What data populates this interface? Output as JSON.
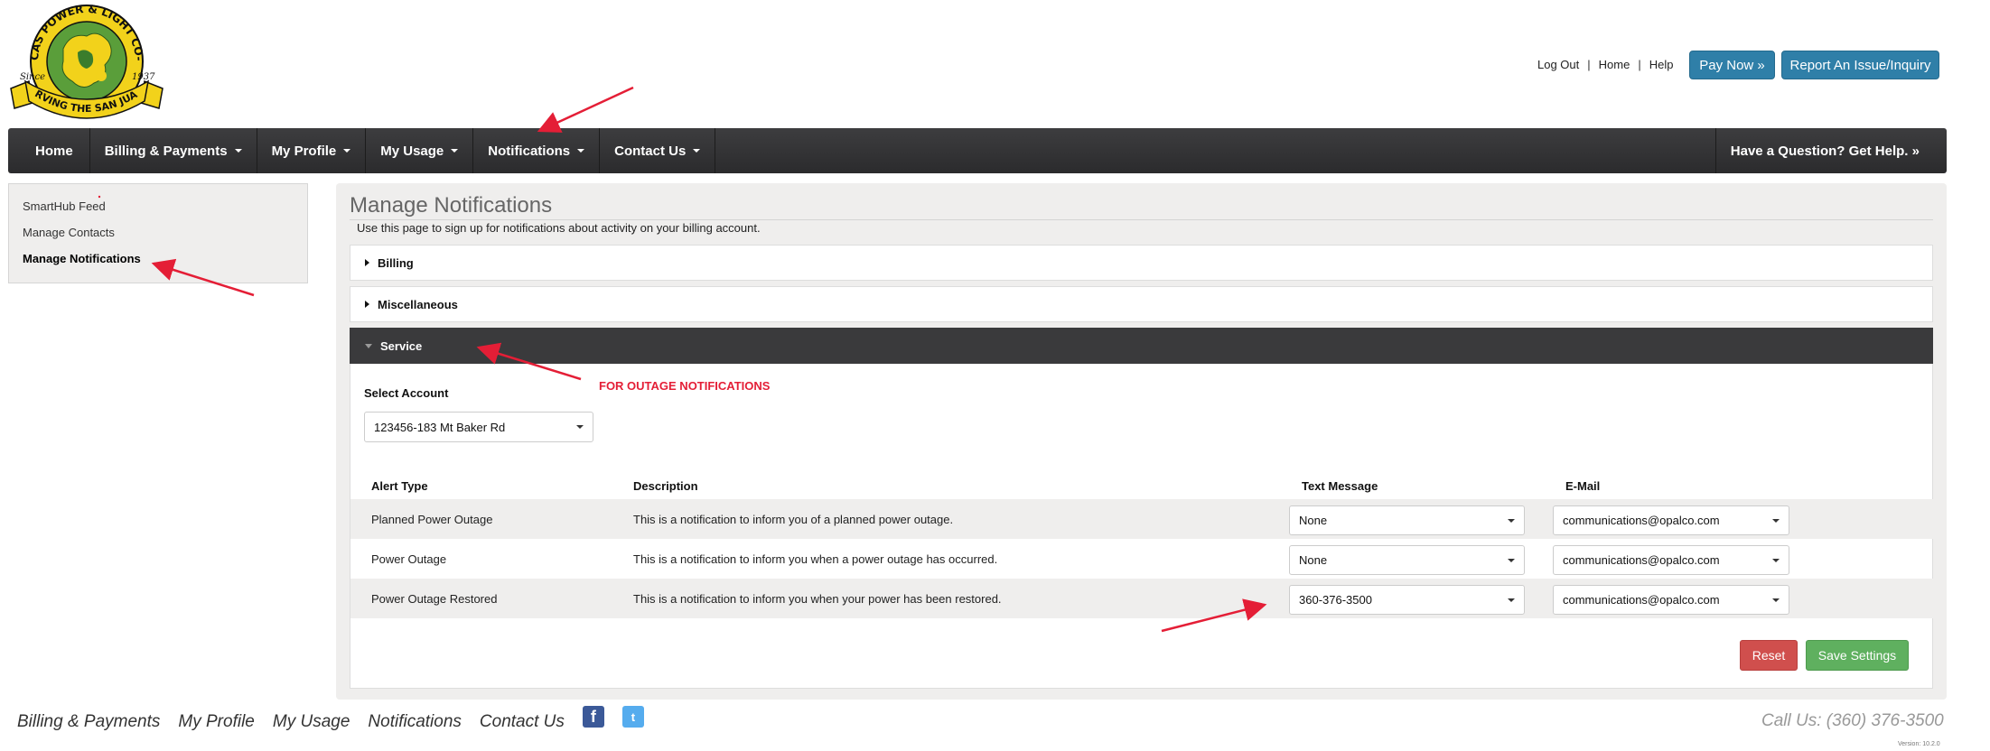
{
  "header": {
    "logo": {
      "name": "ORCAS POWER & LIGHT CO-OP",
      "tagline": "SERVING THE SAN JUANS",
      "since": "Since",
      "year": "1937"
    },
    "links": [
      "Log Out",
      "Home",
      "Help"
    ],
    "pay_now": "Pay Now »",
    "report_issue": "Report An Issue/Inquiry"
  },
  "nav": {
    "items": [
      {
        "label": "Home",
        "dropdown": false
      },
      {
        "label": "Billing & Payments",
        "dropdown": true
      },
      {
        "label": "My Profile",
        "dropdown": true
      },
      {
        "label": "My Usage",
        "dropdown": true
      },
      {
        "label": "Notifications",
        "dropdown": true
      },
      {
        "label": "Contact Us",
        "dropdown": true
      }
    ],
    "help": "Have a Question? Get Help. »"
  },
  "sidebar": {
    "items": [
      "SmartHub Feed",
      "Manage Contacts",
      "Manage Notifications"
    ],
    "active": "Manage Notifications"
  },
  "main": {
    "title": "Manage Notifications",
    "intro": "Use this page to sign up for notifications about activity on your billing account.",
    "sections": {
      "billing": "Billing",
      "misc": "Miscellaneous",
      "service": "Service"
    },
    "select_account_label": "Select Account",
    "account_value": "123456-183 Mt Baker Rd",
    "table": {
      "headers": [
        "Alert Type",
        "Description",
        "Text Message",
        "E-Mail"
      ],
      "rows": [
        {
          "alert": "Planned Power Outage",
          "description": "This is a notification to inform you of a planned power outage.",
          "text": "None",
          "email": "communications@opalco.com"
        },
        {
          "alert": "Power Outage",
          "description": "This is a notification to inform you when a power outage has occurred.",
          "text": "None",
          "email": "communications@opalco.com"
        },
        {
          "alert": "Power Outage Restored",
          "description": "This is a notification to inform you when your power has been restored.",
          "text": "360-376-3500",
          "email": "communications@opalco.com"
        }
      ]
    },
    "reset": "Reset",
    "save": "Save Settings"
  },
  "annotation": {
    "text": "FOR OUTAGE NOTIFICATIONS",
    "color": "#e41e36"
  },
  "footer": {
    "links": [
      "Billing & Payments",
      "My Profile",
      "My Usage",
      "Notifications",
      "Contact Us"
    ],
    "facebook": "f",
    "twitter": "t",
    "call": "Call Us: (360) 376-3500",
    "version": "Version: 10.2.0"
  },
  "colors": {
    "nav_bg": "#333335",
    "primary_button": "#2f7fa8",
    "reset_button": "#d04f4d",
    "save_button": "#5fb05f",
    "logo_yellow": "#f2d21b",
    "logo_green": "#3a7d2c"
  }
}
